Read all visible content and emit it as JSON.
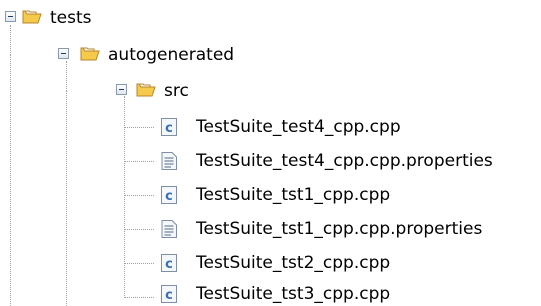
{
  "tree": {
    "nodes": [
      {
        "label": "tests",
        "type": "folder",
        "expanded": true
      },
      {
        "label": "autogenerated",
        "type": "folder",
        "expanded": true
      },
      {
        "label": "src",
        "type": "folder",
        "expanded": true
      },
      {
        "label": "TestSuite_test4_cpp.cpp",
        "type": "cpp-file"
      },
      {
        "label": "TestSuite_test4_cpp.cpp.properties",
        "type": "properties-file"
      },
      {
        "label": "TestSuite_tst1_cpp.cpp",
        "type": "cpp-file"
      },
      {
        "label": "TestSuite_tst1_cpp.cpp.properties",
        "type": "properties-file"
      },
      {
        "label": "TestSuite_tst2_cpp.cpp",
        "type": "cpp-file"
      },
      {
        "label": "TestSuite_tst3_cpp.cpp",
        "type": "cpp-file"
      }
    ]
  },
  "colors": {
    "folder_fill": "#f5c94a",
    "folder_edge": "#b8862a",
    "cpp_letter": "#3a6fb8",
    "tree_line": "#a0a0a0"
  },
  "icons": {
    "folder": "folder-open-icon",
    "cpp": "cpp-file-icon",
    "properties": "text-file-icon",
    "expander": "collapse-icon"
  }
}
